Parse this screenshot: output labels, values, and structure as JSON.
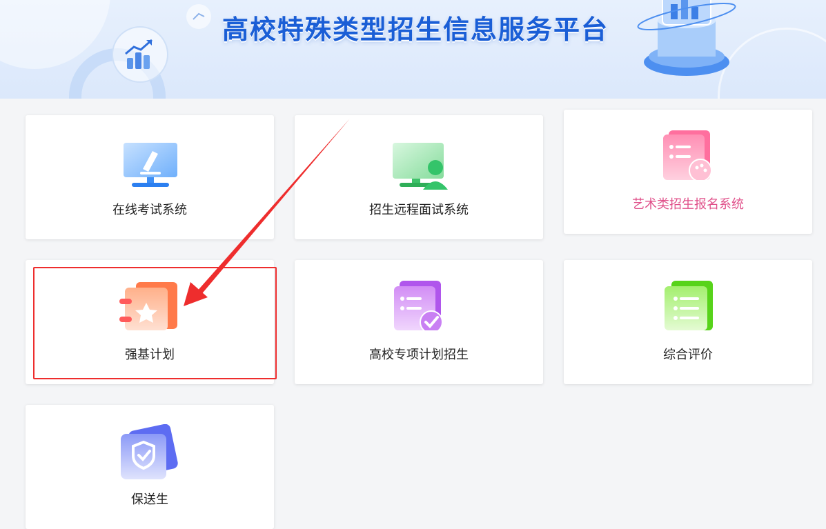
{
  "header": {
    "title": "高校特殊类型招生信息服务平台",
    "colors": {
      "title": "#1a5ed6",
      "banner_bg": "#e2edfc"
    }
  },
  "cards": [
    {
      "label": "在线考试系统",
      "icon": "monitor-pen-icon",
      "accent": "#3d8ef5"
    },
    {
      "label": "招生远程面试系统",
      "icon": "monitor-person-icon",
      "accent": "#34c46a"
    },
    {
      "label": "艺术类招生报名系统",
      "icon": "palette-doc-icon",
      "accent": "#ff6f9e"
    },
    {
      "label": "强基计划",
      "icon": "star-notebook-icon",
      "accent": "#ff7040"
    },
    {
      "label": "高校专项计划招生",
      "icon": "checklist-doc-icon",
      "accent": "#b056ec"
    },
    {
      "label": "综合评价",
      "icon": "list-doc-icon",
      "accent": "#5ad51c"
    },
    {
      "label": "保送生",
      "icon": "shield-check-icon",
      "accent": "#5d6cf2"
    }
  ],
  "annotation": {
    "highlight_color": "#ee2d2d"
  }
}
